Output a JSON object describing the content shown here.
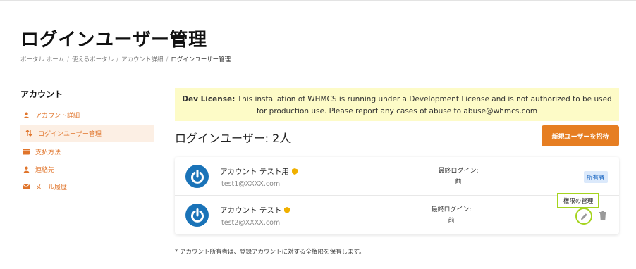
{
  "page": {
    "title": "ログインユーザー管理"
  },
  "breadcrumb": {
    "items": [
      "ポータル ホーム",
      "使えるポータル",
      "アカウント詳細",
      "ログインユーザー管理"
    ]
  },
  "sidebar": {
    "title": "アカウント",
    "items": [
      {
        "label": "アカウント詳細",
        "icon": "user-icon"
      },
      {
        "label": "ログインユーザー管理",
        "icon": "swap-arrows-icon"
      },
      {
        "label": "支払方法",
        "icon": "credit-card-icon"
      },
      {
        "label": "連絡先",
        "icon": "user-icon"
      },
      {
        "label": "メール履歴",
        "icon": "envelope-icon"
      }
    ],
    "accent_color": "#e0742a"
  },
  "banner": {
    "bold": "Dev License:",
    "line1": " This installation of WHMCS is running under a Development License and is not authorized to be used",
    "line2": "for production use. Please report any cases of abuse to abuse@whmcs.com"
  },
  "users_section": {
    "title": "ログインユーザー: 2人",
    "invite_button": "新規ユーザーを招待"
  },
  "users": [
    {
      "name": "アカウント テスト用",
      "email": "test1@XXXX.com",
      "last_login_label": "最終ログイン:",
      "last_login_value": "前",
      "badge": "所有者"
    },
    {
      "name": "アカウント テスト",
      "email": "test2@XXXX.com",
      "last_login_label": "最終ログイン:",
      "last_login_value": "前",
      "permissions_label": "権限の管理"
    }
  ],
  "footnote": "* アカウント所有者は、登録アカウントに対する全権限を保有します。",
  "colors": {
    "accent": "#e67e22",
    "highlight": "#a5d41e",
    "avatar": "#1a73b8",
    "banner_bg": "#fdfbc7"
  }
}
